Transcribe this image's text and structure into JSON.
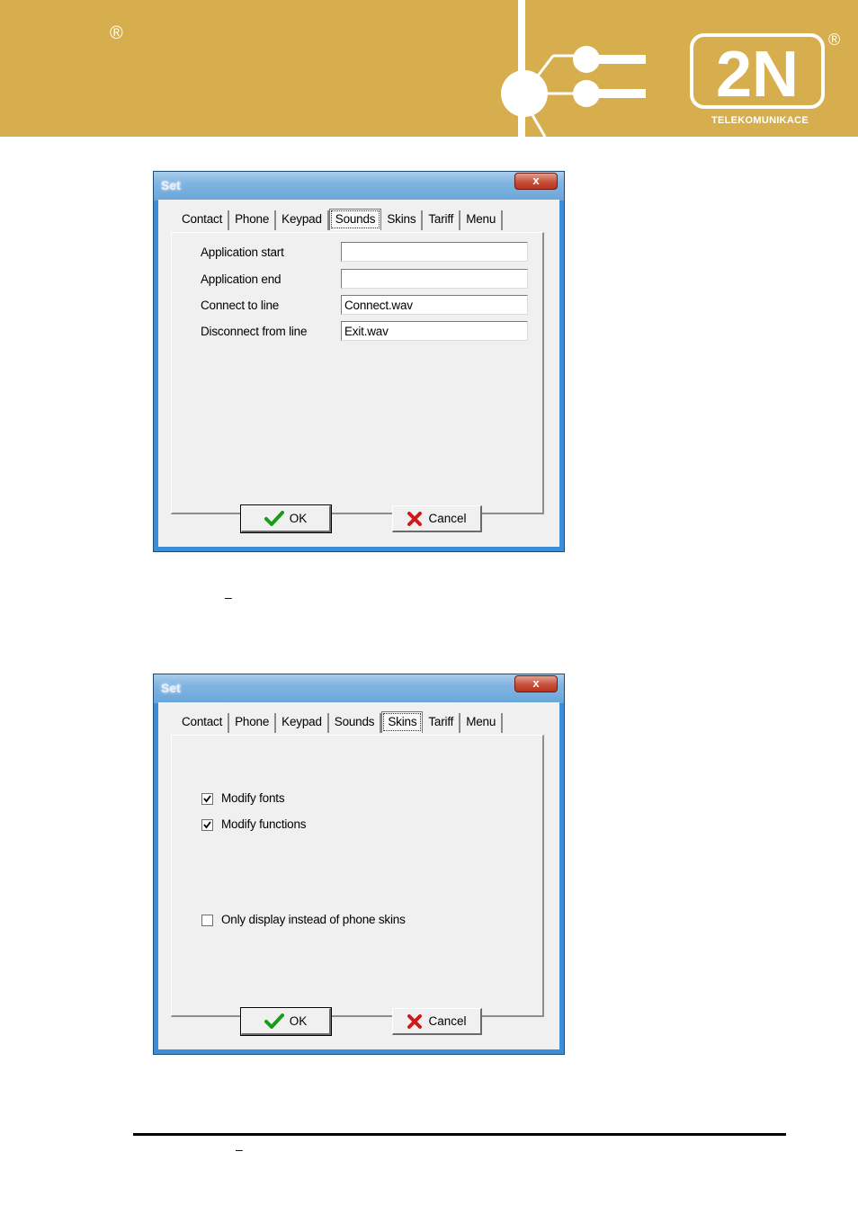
{
  "header": {
    "registered_mark": "®",
    "logo_text": "2N",
    "logo_registered": "®",
    "logo_subtitle": "TELEKOMUNIKACE"
  },
  "colors": {
    "banner": "#d6ae4e",
    "window_frame": "#3b8fd8",
    "dialog_bg": "#f0f0f0",
    "ok_check": "#1a9b1a",
    "cancel_x": "#d01a1a"
  },
  "dialog1": {
    "title": "Set",
    "close_label": "x",
    "tabs": [
      {
        "label": "Contact"
      },
      {
        "label": "Phone"
      },
      {
        "label": "Keypad"
      },
      {
        "label": "Sounds"
      },
      {
        "label": "Skins"
      },
      {
        "label": "Tariff"
      },
      {
        "label": "Menu"
      }
    ],
    "active_tab": "Sounds",
    "fields": [
      {
        "label": "Application start",
        "value": ""
      },
      {
        "label": "Application end",
        "value": ""
      },
      {
        "label": "Connect to line",
        "value": "Connect.wav"
      },
      {
        "label": "Disconnect from line",
        "value": "Exit.wav"
      }
    ],
    "ok_label": "OK",
    "cancel_label": "Cancel"
  },
  "caption1_dash": "–",
  "dialog2": {
    "title": "Set",
    "close_label": "x",
    "tabs": [
      {
        "label": "Contact"
      },
      {
        "label": "Phone"
      },
      {
        "label": "Keypad"
      },
      {
        "label": "Sounds"
      },
      {
        "label": "Skins"
      },
      {
        "label": "Tariff"
      },
      {
        "label": "Menu"
      }
    ],
    "active_tab": "Skins",
    "checkboxes": [
      {
        "label": "Modify fonts",
        "checked": true
      },
      {
        "label": "Modify functions",
        "checked": true
      },
      {
        "label": "Only display instead of phone skins",
        "checked": false
      }
    ],
    "ok_label": "OK",
    "cancel_label": "Cancel"
  },
  "caption2_dash": "–"
}
